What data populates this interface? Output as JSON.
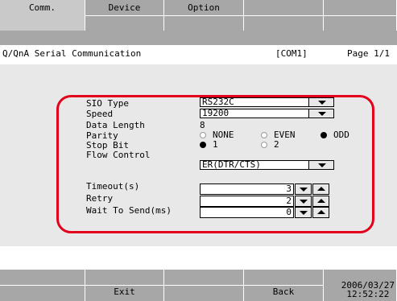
{
  "tabs": {
    "comm": "Comm.",
    "device": "Device",
    "option": "Option",
    "blank1": "",
    "blank2": ""
  },
  "header": {
    "mode": "Q/QnA Serial Communication",
    "port": "[COM1]",
    "page": "Page 1/1"
  },
  "form": {
    "sio_type": {
      "label": "SIO Type",
      "value": "RS232C"
    },
    "speed": {
      "label": "Speed",
      "value": "19200"
    },
    "data_length": {
      "label": "Data Length",
      "value": "8"
    },
    "parity": {
      "label": "Parity",
      "options": [
        "NONE",
        "EVEN",
        "ODD"
      ],
      "selected": "ODD"
    },
    "stop_bit": {
      "label": "Stop Bit",
      "options": [
        "1",
        "2"
      ],
      "selected": "1"
    },
    "flow_control": {
      "label": "Flow Control",
      "value": "ER(DTR/CTS)"
    },
    "timeout": {
      "label": "Timeout(s)",
      "value": "3"
    },
    "retry": {
      "label": "Retry",
      "value": "2"
    },
    "wait_to_send": {
      "label": "Wait To Send(ms)",
      "value": "0"
    }
  },
  "bottom": {
    "exit": "Exit",
    "back": "Back",
    "date": "2006/03/27",
    "time": "12:52:22"
  },
  "colors": {
    "accent_red": "#e3001b",
    "tab_gray": "#a7a7a7",
    "panel_gray": "#e8e8e8"
  }
}
